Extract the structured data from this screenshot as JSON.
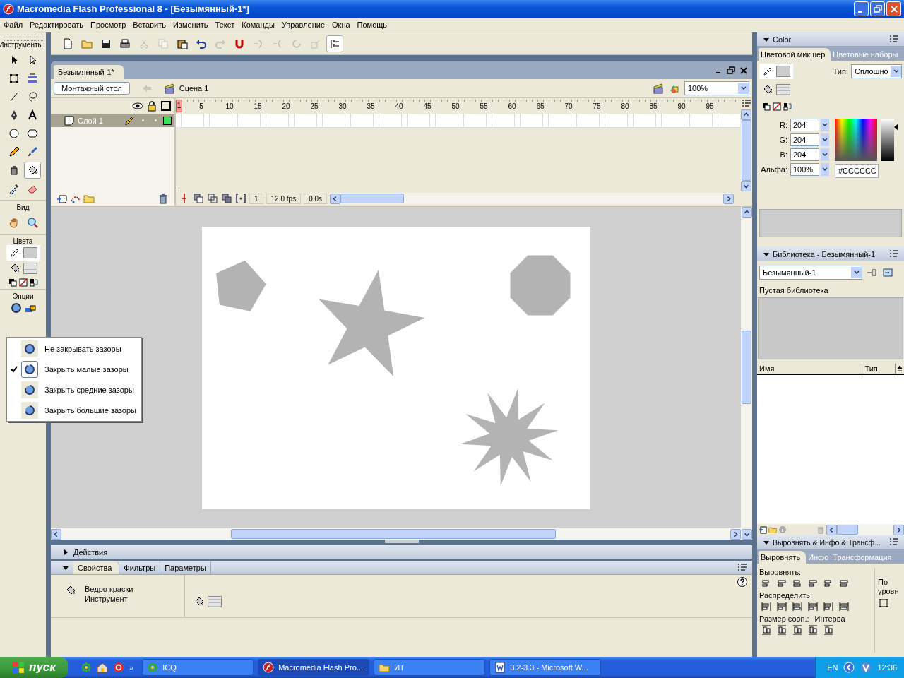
{
  "window": {
    "title": "Macromedia Flash Professional 8 - [Безымянный-1*]"
  },
  "menu": [
    "Файл",
    "Редактировать",
    "Просмотр",
    "Вставить",
    "Изменить",
    "Текст",
    "Команды",
    "Управление",
    "Окна",
    "Помощь"
  ],
  "toolbar": [
    {
      "kind": "new",
      "disabled": false,
      "pressed": false
    },
    {
      "kind": "open",
      "disabled": false,
      "pressed": false
    },
    {
      "kind": "save",
      "disabled": false,
      "pressed": false
    },
    {
      "kind": "print",
      "disabled": false,
      "pressed": false
    },
    {
      "kind": "cut",
      "disabled": true,
      "pressed": false
    },
    {
      "kind": "copy",
      "disabled": true,
      "pressed": false
    },
    {
      "kind": "paste",
      "disabled": false,
      "pressed": false
    },
    {
      "kind": "undo",
      "disabled": false,
      "pressed": false
    },
    {
      "kind": "redo",
      "disabled": true,
      "pressed": false
    },
    {
      "kind": "snap",
      "disabled": false,
      "pressed": false
    },
    {
      "kind": "smooth",
      "disabled": true,
      "pressed": false
    },
    {
      "kind": "straighten",
      "disabled": true,
      "pressed": false
    },
    {
      "kind": "rotate",
      "disabled": true,
      "pressed": false
    },
    {
      "kind": "scale",
      "disabled": true,
      "pressed": false
    },
    {
      "kind": "align",
      "disabled": false,
      "pressed": true
    }
  ],
  "tools": {
    "title": "Инструменты",
    "items": [
      {
        "kind": "arrow",
        "selected": false
      },
      {
        "kind": "subselect",
        "selected": false
      },
      {
        "kind": "free-transform",
        "selected": false
      },
      {
        "kind": "fill-transform",
        "selected": false
      },
      {
        "kind": "line",
        "selected": false
      },
      {
        "kind": "lasso",
        "selected": false
      },
      {
        "kind": "pen",
        "selected": false
      },
      {
        "kind": "text",
        "selected": false
      },
      {
        "kind": "oval",
        "selected": false
      },
      {
        "kind": "polystar",
        "selected": false
      },
      {
        "kind": "pencil",
        "selected": false
      },
      {
        "kind": "brush",
        "selected": false
      },
      {
        "kind": "ink-bottle",
        "selected": false
      },
      {
        "kind": "paint-bucket",
        "selected": true
      },
      {
        "kind": "eyedropper",
        "selected": false
      },
      {
        "kind": "eraser",
        "selected": false
      }
    ]
  },
  "view": {
    "title": "Вид",
    "items": [
      {
        "kind": "hand"
      },
      {
        "kind": "zoom"
      }
    ]
  },
  "colors": {
    "title": "Цвета"
  },
  "options": {
    "title": "Опции"
  },
  "gap_menu": [
    {
      "label": "Не закрывать зазоры",
      "selected": false
    },
    {
      "label": "Закрыть малые зазоры",
      "selected": true
    },
    {
      "label": "Закрыть средние зазоры",
      "selected": false
    },
    {
      "label": "Закрыть большие зазоры",
      "selected": false
    }
  ],
  "document": {
    "tab": "Безымянный-1*",
    "timeline_button": "Монтажный стол",
    "scene": "Сцена 1",
    "zoom": "100%"
  },
  "timeline": {
    "frame_numbers": [
      "1",
      "5",
      "10",
      "15",
      "20",
      "25",
      "30",
      "35",
      "40",
      "45",
      "50",
      "55",
      "60",
      "65",
      "70",
      "75",
      "80",
      "85",
      "90",
      "95"
    ],
    "layers": [
      {
        "name": "Слой 1",
        "selected": true
      }
    ],
    "current_frame": "1",
    "frame_rate": "12.0 fps",
    "elapsed": "0.0s"
  },
  "stage": {
    "shapes": [
      {
        "kind": "pentagon"
      },
      {
        "kind": "star"
      },
      {
        "kind": "octagon"
      },
      {
        "kind": "burst"
      }
    ]
  },
  "actions_panel": {
    "title": "Действия",
    "expanded": false
  },
  "properties_panel": {
    "tabs": [
      {
        "label": "Свойства",
        "selected": true
      },
      {
        "label": "Фильтры",
        "selected": false
      },
      {
        "label": "Параметры",
        "selected": false
      }
    ],
    "tool_name": "Ведро краски",
    "tool_type": "Инструмент"
  },
  "color_panel": {
    "title": "Color",
    "tabs": [
      {
        "label": "Цветовой микшер",
        "selected": true
      },
      {
        "label": "Цветовые наборы",
        "selected": false
      }
    ],
    "type_label": "Тип:",
    "type_value": "Сплошно",
    "fields": [
      {
        "label": "R:",
        "value": "204"
      },
      {
        "label": "G:",
        "value": "204"
      },
      {
        "label": "B:",
        "value": "204"
      },
      {
        "label": "Альфа:",
        "value": "100%"
      }
    ],
    "brightness": {
      "level": 0.8
    },
    "hex": "#CCCCCC"
  },
  "library_panel": {
    "title": "Библиотека - Безымянный-1",
    "document": "Безымянный-1",
    "preview_text": "Пустая библиотека",
    "columns": [
      "Имя",
      "Тип"
    ]
  },
  "align_panel": {
    "title": "Выровнять & Инфо & Трансф...",
    "tabs": [
      {
        "label": "Выровнять",
        "selected": true
      },
      {
        "label": "Инфо",
        "selected": false
      },
      {
        "label": "Трансформация",
        "selected": false
      }
    ],
    "sections": [
      "Выровнять:",
      "Распределить:",
      "Размер совп.:"
    ],
    "spacing_label": "Интерва",
    "stage_label": "По уровн"
  },
  "taskbar": {
    "start": "пуск",
    "more": "»",
    "tasks": [
      {
        "kind": "icq",
        "label": "ICQ",
        "selected": false
      },
      {
        "kind": "flash",
        "label": "Macromedia Flash Pro...",
        "selected": true
      },
      {
        "kind": "folder",
        "label": "ИТ",
        "selected": false
      },
      {
        "kind": "word",
        "label": "3.2-3.3 - Microsoft W...",
        "selected": false
      }
    ],
    "language": "EN",
    "time": "12:36"
  }
}
